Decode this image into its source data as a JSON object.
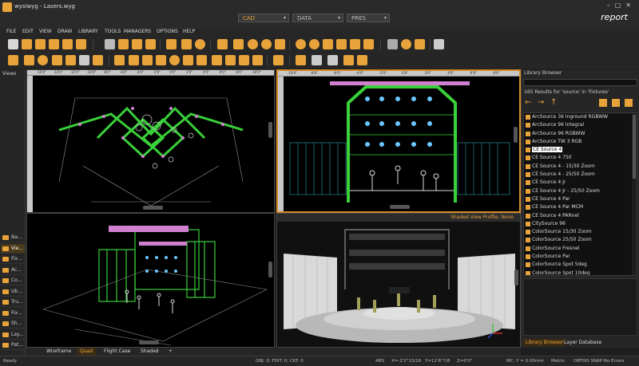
{
  "window": {
    "title": "wysiwyg - Lasers.wyg",
    "report_label": "report"
  },
  "modes": {
    "cad": "CAD",
    "data": "DATA",
    "pres": "PRES"
  },
  "menu": [
    "FILE",
    "EDIT",
    "VIEW",
    "DRAW",
    "LIBRARY",
    "TOOLS",
    "MANAGERS",
    "OPTIONS",
    "HELP"
  ],
  "views_panel": {
    "title": "Views",
    "items": [
      "Na...",
      "Vie...",
      "Fix...",
      "Ac...",
      "Co...",
      "Ub...",
      "Tru...",
      "Fix...",
      "Sh...",
      "Lay...",
      "Pat..."
    ]
  },
  "viewports": {
    "top_right_label": "",
    "shaded_profile": "Shaded View Profile: None",
    "ruler_top_left": [
      "-16'0\"",
      "-14'0\"",
      "-12'0\"",
      "-10'0\"",
      "-8'0\"",
      "-6'0\"",
      "-4'0\"",
      "-2'0\"",
      "0'0\"",
      "2'0\"",
      "4'0\"",
      "6'0\"",
      "8'0\"",
      "10'0\""
    ],
    "ruler_top_right": [
      "-10'0\"",
      "-8'0\"",
      "-6'0\"",
      "-4'0\"",
      "-2'0\"",
      "0'0\"",
      "2'0\"",
      "4'0\"",
      "6'0\"",
      "8'0\""
    ]
  },
  "view_tabs": [
    "Wireframe",
    "Quad",
    "Flight Case",
    "Shaded",
    "+"
  ],
  "library": {
    "title": "Library Browser",
    "search_value": "",
    "results": "165 Results for 'source' in 'Fixtures'",
    "items": [
      "ArcSource 36 Inground RGBWW",
      "ArcSource 96 Integral",
      "ArcSource 96 RGBWW",
      "ArcSource TW 3 RGB",
      "CE Source 4",
      "CE Source 4 750",
      "CE Source 4 - 15/30 Zoom",
      "CE Source 4 - 25/50 Zoom",
      "CE Source 4 Jr",
      "CE Source 4 Jr - 25/50 Zoom",
      "CE Source 4 Par",
      "CE Source 4 Par MCM",
      "CE Source 4 PARnel",
      "CitySource 96",
      "ColorSource 15/30 Zoom",
      "ColorSource 25/50 Zoom",
      "ColorSource Fresnel",
      "ColorSource Par",
      "ColorSource Spot 5deg",
      "ColorSource Spot 10deg"
    ],
    "selected_index": 4,
    "tabs": [
      "Library Browser",
      "Layer Database"
    ]
  },
  "status": {
    "ready": "Ready",
    "obj": "OBJ: 0; FDIT: 0; CKT: 0",
    "abs": "ABS",
    "x": "X=-2'2\"13/16",
    "y": "Y=11'6\"7/8",
    "z": "Z=0'0\"",
    "mc": "MC: Y = 0.00mm",
    "metric": "Metric",
    "flags": "ORTHO  SNAP  No Errors"
  },
  "colors": {
    "accent": "#e8a33a",
    "truss": "#39d039",
    "background": "#000000"
  }
}
